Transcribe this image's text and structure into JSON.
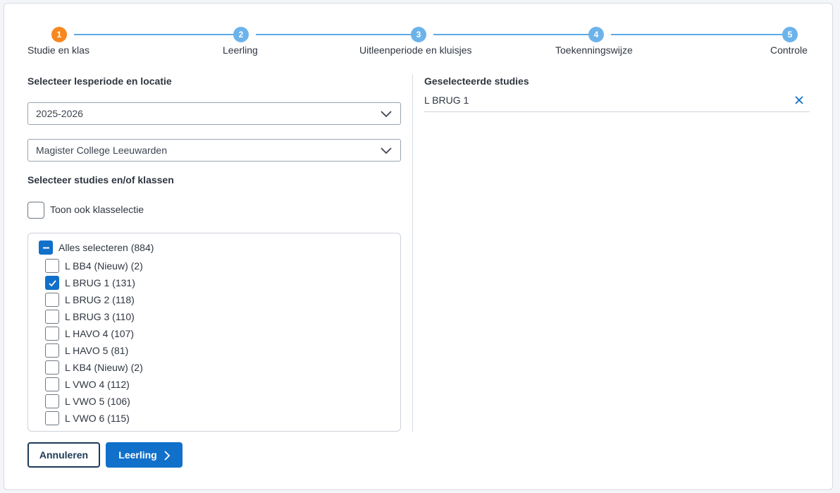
{
  "stepper": {
    "steps": [
      {
        "number": "1",
        "label": "Studie en klas",
        "state": "active"
      },
      {
        "number": "2",
        "label": "Leerling",
        "state": "todo"
      },
      {
        "number": "3",
        "label": "Uitleenperiode en kluisjes",
        "state": "todo"
      },
      {
        "number": "4",
        "label": "Toekenningswijze",
        "state": "todo"
      },
      {
        "number": "5",
        "label": "Controle",
        "state": "todo"
      }
    ]
  },
  "left": {
    "period_title": "Selecteer lesperiode en locatie",
    "period_select": {
      "value": "2025-2026"
    },
    "location_select": {
      "value": "Magister College Leeuwarden"
    },
    "studies_title": "Selecteer studies en/of klassen",
    "show_classes": {
      "label": "Toon ook klasselectie",
      "checked": false
    },
    "select_all": {
      "label": "Alles selecteren (884)",
      "state": "partial"
    },
    "studies": [
      {
        "label": "L BB4 (Nieuw) (2)",
        "checked": false
      },
      {
        "label": "L BRUG 1 (131)",
        "checked": true
      },
      {
        "label": "L BRUG 2 (118)",
        "checked": false
      },
      {
        "label": "L BRUG 3 (110)",
        "checked": false
      },
      {
        "label": "L HAVO 4 (107)",
        "checked": false
      },
      {
        "label": "L HAVO 5 (81)",
        "checked": false
      },
      {
        "label": "L KB4 (Nieuw) (2)",
        "checked": false
      },
      {
        "label": "L VWO 4 (112)",
        "checked": false
      },
      {
        "label": "L VWO 5 (106)",
        "checked": false
      },
      {
        "label": "L VWO 6 (115)",
        "checked": false
      }
    ]
  },
  "right": {
    "title": "Geselecteerde studies",
    "selected": [
      {
        "label": "L BRUG 1"
      }
    ]
  },
  "actions": {
    "cancel_label": "Annuleren",
    "next_label": "Leerling"
  },
  "colors": {
    "primary": "#1170c9",
    "active_step": "#f7881f",
    "step_todo": "#6cb3ea",
    "step_line": "#5aa9e6"
  }
}
